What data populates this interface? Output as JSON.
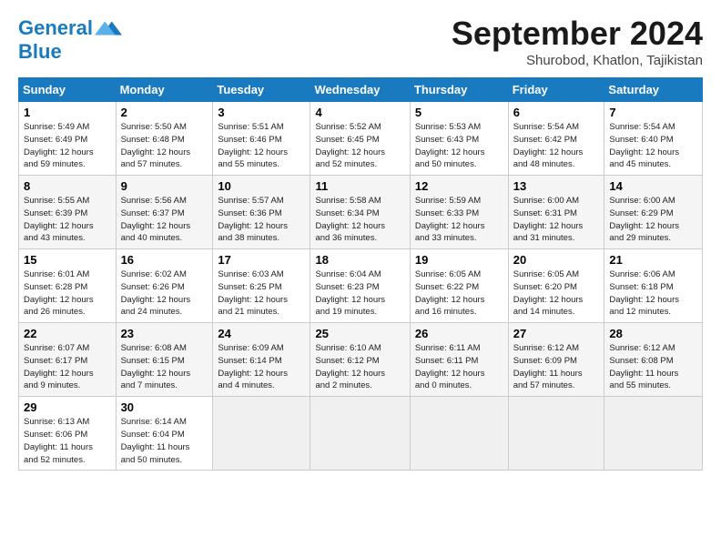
{
  "header": {
    "logo_line1": "General",
    "logo_line2": "Blue",
    "month_year": "September 2024",
    "location": "Shurobod, Khatlon, Tajikistan"
  },
  "columns": [
    "Sunday",
    "Monday",
    "Tuesday",
    "Wednesday",
    "Thursday",
    "Friday",
    "Saturday"
  ],
  "weeks": [
    [
      {
        "day": "1",
        "detail": "Sunrise: 5:49 AM\nSunset: 6:49 PM\nDaylight: 12 hours\nand 59 minutes."
      },
      {
        "day": "2",
        "detail": "Sunrise: 5:50 AM\nSunset: 6:48 PM\nDaylight: 12 hours\nand 57 minutes."
      },
      {
        "day": "3",
        "detail": "Sunrise: 5:51 AM\nSunset: 6:46 PM\nDaylight: 12 hours\nand 55 minutes."
      },
      {
        "day": "4",
        "detail": "Sunrise: 5:52 AM\nSunset: 6:45 PM\nDaylight: 12 hours\nand 52 minutes."
      },
      {
        "day": "5",
        "detail": "Sunrise: 5:53 AM\nSunset: 6:43 PM\nDaylight: 12 hours\nand 50 minutes."
      },
      {
        "day": "6",
        "detail": "Sunrise: 5:54 AM\nSunset: 6:42 PM\nDaylight: 12 hours\nand 48 minutes."
      },
      {
        "day": "7",
        "detail": "Sunrise: 5:54 AM\nSunset: 6:40 PM\nDaylight: 12 hours\nand 45 minutes."
      }
    ],
    [
      {
        "day": "8",
        "detail": "Sunrise: 5:55 AM\nSunset: 6:39 PM\nDaylight: 12 hours\nand 43 minutes."
      },
      {
        "day": "9",
        "detail": "Sunrise: 5:56 AM\nSunset: 6:37 PM\nDaylight: 12 hours\nand 40 minutes."
      },
      {
        "day": "10",
        "detail": "Sunrise: 5:57 AM\nSunset: 6:36 PM\nDaylight: 12 hours\nand 38 minutes."
      },
      {
        "day": "11",
        "detail": "Sunrise: 5:58 AM\nSunset: 6:34 PM\nDaylight: 12 hours\nand 36 minutes."
      },
      {
        "day": "12",
        "detail": "Sunrise: 5:59 AM\nSunset: 6:33 PM\nDaylight: 12 hours\nand 33 minutes."
      },
      {
        "day": "13",
        "detail": "Sunrise: 6:00 AM\nSunset: 6:31 PM\nDaylight: 12 hours\nand 31 minutes."
      },
      {
        "day": "14",
        "detail": "Sunrise: 6:00 AM\nSunset: 6:29 PM\nDaylight: 12 hours\nand 29 minutes."
      }
    ],
    [
      {
        "day": "15",
        "detail": "Sunrise: 6:01 AM\nSunset: 6:28 PM\nDaylight: 12 hours\nand 26 minutes."
      },
      {
        "day": "16",
        "detail": "Sunrise: 6:02 AM\nSunset: 6:26 PM\nDaylight: 12 hours\nand 24 minutes."
      },
      {
        "day": "17",
        "detail": "Sunrise: 6:03 AM\nSunset: 6:25 PM\nDaylight: 12 hours\nand 21 minutes."
      },
      {
        "day": "18",
        "detail": "Sunrise: 6:04 AM\nSunset: 6:23 PM\nDaylight: 12 hours\nand 19 minutes."
      },
      {
        "day": "19",
        "detail": "Sunrise: 6:05 AM\nSunset: 6:22 PM\nDaylight: 12 hours\nand 16 minutes."
      },
      {
        "day": "20",
        "detail": "Sunrise: 6:05 AM\nSunset: 6:20 PM\nDaylight: 12 hours\nand 14 minutes."
      },
      {
        "day": "21",
        "detail": "Sunrise: 6:06 AM\nSunset: 6:18 PM\nDaylight: 12 hours\nand 12 minutes."
      }
    ],
    [
      {
        "day": "22",
        "detail": "Sunrise: 6:07 AM\nSunset: 6:17 PM\nDaylight: 12 hours\nand 9 minutes."
      },
      {
        "day": "23",
        "detail": "Sunrise: 6:08 AM\nSunset: 6:15 PM\nDaylight: 12 hours\nand 7 minutes."
      },
      {
        "day": "24",
        "detail": "Sunrise: 6:09 AM\nSunset: 6:14 PM\nDaylight: 12 hours\nand 4 minutes."
      },
      {
        "day": "25",
        "detail": "Sunrise: 6:10 AM\nSunset: 6:12 PM\nDaylight: 12 hours\nand 2 minutes."
      },
      {
        "day": "26",
        "detail": "Sunrise: 6:11 AM\nSunset: 6:11 PM\nDaylight: 12 hours\nand 0 minutes."
      },
      {
        "day": "27",
        "detail": "Sunrise: 6:12 AM\nSunset: 6:09 PM\nDaylight: 11 hours\nand 57 minutes."
      },
      {
        "day": "28",
        "detail": "Sunrise: 6:12 AM\nSunset: 6:08 PM\nDaylight: 11 hours\nand 55 minutes."
      }
    ],
    [
      {
        "day": "29",
        "detail": "Sunrise: 6:13 AM\nSunset: 6:06 PM\nDaylight: 11 hours\nand 52 minutes."
      },
      {
        "day": "30",
        "detail": "Sunrise: 6:14 AM\nSunset: 6:04 PM\nDaylight: 11 hours\nand 50 minutes."
      },
      {
        "day": "",
        "detail": ""
      },
      {
        "day": "",
        "detail": ""
      },
      {
        "day": "",
        "detail": ""
      },
      {
        "day": "",
        "detail": ""
      },
      {
        "day": "",
        "detail": ""
      }
    ]
  ]
}
